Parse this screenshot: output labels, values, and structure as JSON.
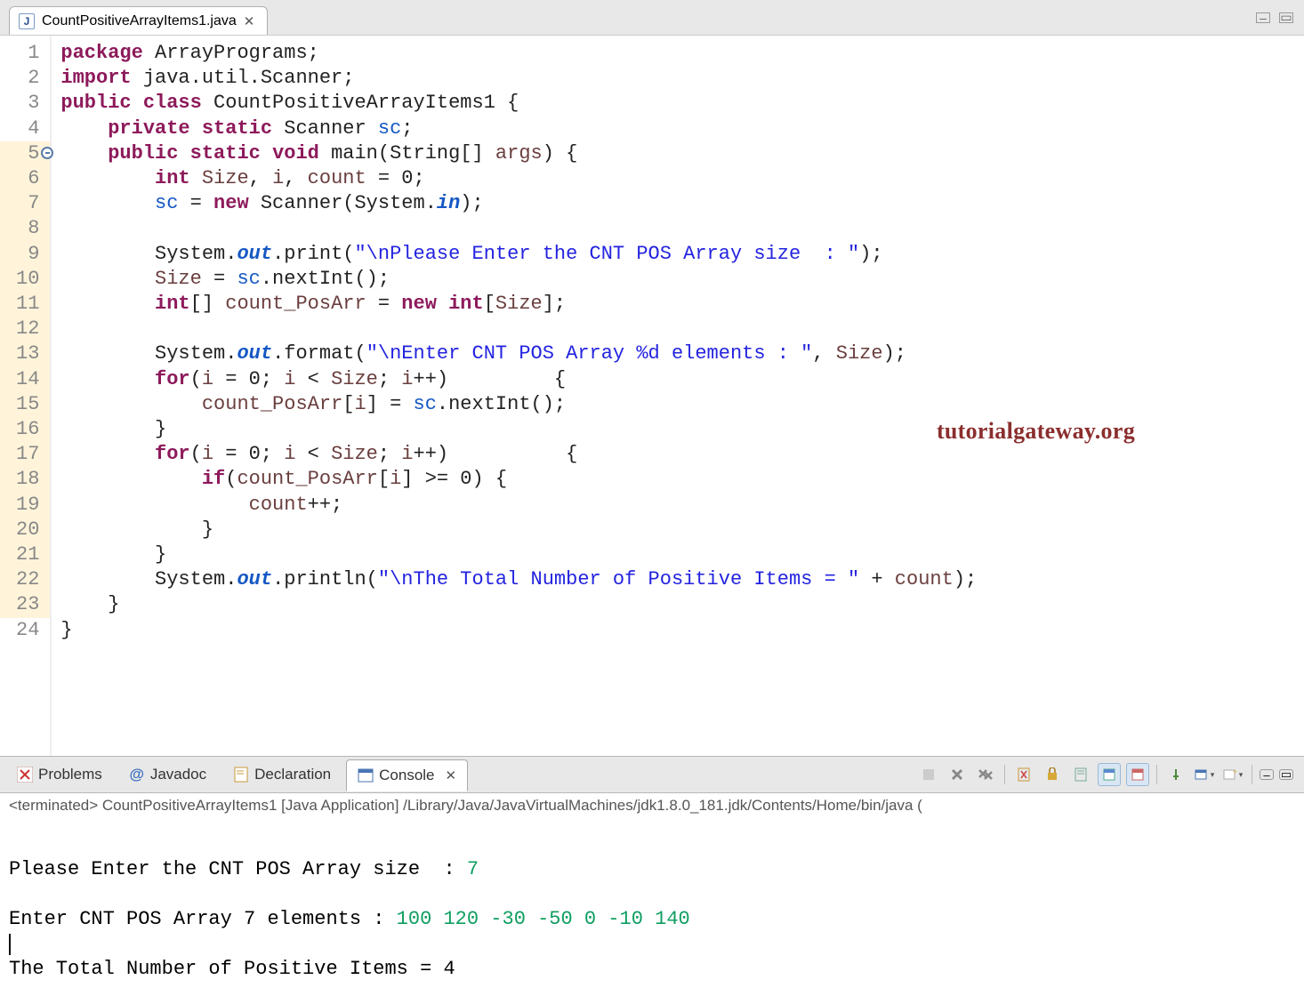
{
  "tab": {
    "filename": "CountPositiveArrayItems1.java"
  },
  "gutter": {
    "lines": [
      "1",
      "2",
      "3",
      "4",
      "5",
      "6",
      "7",
      "8",
      "9",
      "10",
      "11",
      "12",
      "13",
      "14",
      "15",
      "16",
      "17",
      "18",
      "19",
      "20",
      "21",
      "22",
      "23",
      "24"
    ],
    "highlighted": [
      5,
      6,
      7,
      8,
      9,
      10,
      11,
      12,
      13,
      14,
      15,
      16,
      17,
      18,
      19,
      20,
      21,
      22,
      23
    ],
    "marker_line": 5
  },
  "code": {
    "l1": {
      "t1": "package",
      "t2": " ArrayPrograms;"
    },
    "l2": {
      "t1": "import",
      "t2": " java.util.Scanner;"
    },
    "l3": {
      "t1": "public",
      "t2": "class",
      "t3": " CountPositiveArrayItems1 {"
    },
    "l4": {
      "t1": "private",
      "t2": "static",
      "t3": " Scanner ",
      "t4": "sc",
      "t5": ";"
    },
    "l5": {
      "t1": "public",
      "t2": "static",
      "t3": "void",
      "t4": " main(String[] ",
      "t5": "args",
      "t6": ") {"
    },
    "l6": {
      "t1": "int",
      "t2": "Size",
      "t3": ", ",
      "t4": "i",
      "t5": ", ",
      "t6": "count",
      "t7": " = 0;"
    },
    "l7": {
      "t1": "sc",
      "t2": " = ",
      "t3": "new",
      "t4": " Scanner(System.",
      "t5": "in",
      "t6": ");"
    },
    "l9": {
      "t1": "System.",
      "t2": "out",
      "t3": ".print(",
      "t4": "\"\\nPlease Enter the CNT POS Array size  : \"",
      "t5": ");"
    },
    "l10": {
      "t1": "Size",
      "t2": " = ",
      "t3": "sc",
      "t4": ".nextInt();"
    },
    "l11": {
      "t1": "int",
      "t2": "[] ",
      "t3": "count_PosArr",
      "t4": " = ",
      "t5": "new",
      "t6": "int",
      "t7": "[",
      "t8": "Size",
      "t9": "];"
    },
    "l13": {
      "t1": "System.",
      "t2": "out",
      "t3": ".format(",
      "t4": "\"\\nEnter CNT POS Array %d elements : \"",
      "t5": ", ",
      "t6": "Size",
      "t7": ");"
    },
    "l14": {
      "t1": "for",
      "t2": "(",
      "t3": "i",
      "t4": " = 0; ",
      "t5": "i",
      "t6": " < ",
      "t7": "Size",
      "t8": "; ",
      "t9": "i",
      "t10": "++)         {"
    },
    "l15": {
      "t1": "count_PosArr",
      "t2": "[",
      "t3": "i",
      "t4": "] = ",
      "t5": "sc",
      "t6": ".nextInt();"
    },
    "l16": {
      "t1": "}"
    },
    "l17": {
      "t1": "for",
      "t2": "(",
      "t3": "i",
      "t4": " = 0; ",
      "t5": "i",
      "t6": " < ",
      "t7": "Size",
      "t8": "; ",
      "t9": "i",
      "t10": "++)          {"
    },
    "l18": {
      "t1": "if",
      "t2": "(",
      "t3": "count_PosArr",
      "t4": "[",
      "t5": "i",
      "t6": "] >= 0) {"
    },
    "l19": {
      "t1": "count",
      "t2": "++;"
    },
    "l20": {
      "t1": "}"
    },
    "l21": {
      "t1": "}"
    },
    "l22": {
      "t1": "System.",
      "t2": "out",
      "t3": ".println(",
      "t4": "\"\\nThe Total Number of Positive Items = \"",
      "t5": " + ",
      "t6": "count",
      "t7": ");"
    },
    "l23": {
      "t1": "}"
    },
    "l24": {
      "t1": "}"
    }
  },
  "watermark": "tutorialgateway.org",
  "bottom_tabs": {
    "problems": "Problems",
    "javadoc": "Javadoc",
    "declaration": "Declaration",
    "console": "Console"
  },
  "console": {
    "header": "<terminated> CountPositiveArrayItems1 [Java Application] /Library/Java/JavaVirtualMachines/jdk1.8.0_181.jdk/Contents/Home/bin/java (",
    "line1_prompt": "Please Enter the CNT POS Array size  : ",
    "line1_input": "7",
    "line2_prompt": "Enter CNT POS Array 7 elements : ",
    "line2_input": "100 120 -30 -50 0 -10 140",
    "line3": "The Total Number of Positive Items = 4"
  }
}
